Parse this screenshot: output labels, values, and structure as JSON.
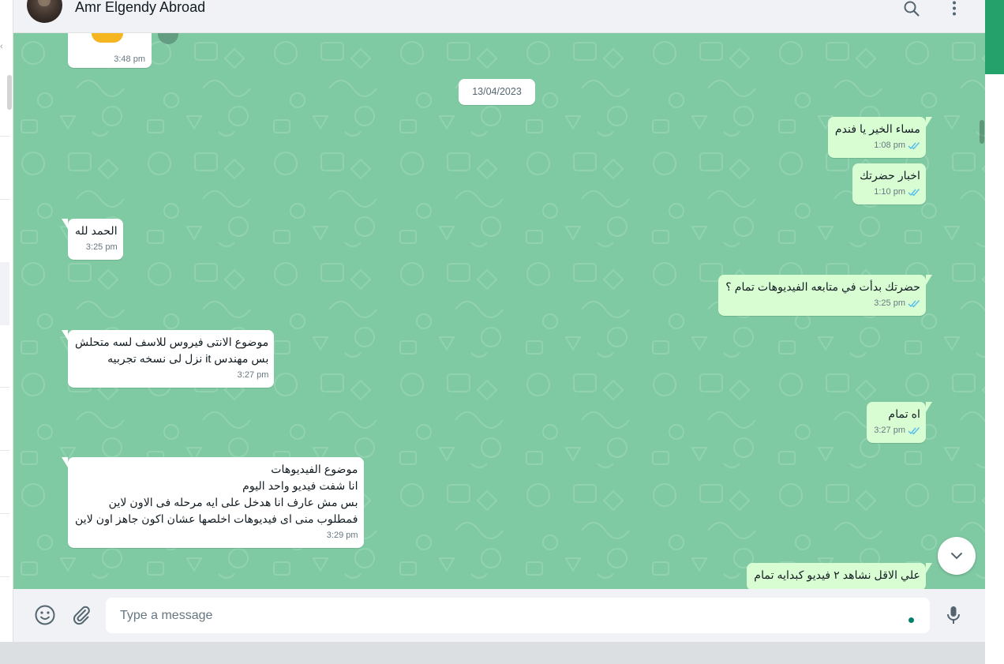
{
  "header": {
    "contact_name": "Amr Elgendy Abroad",
    "icons": [
      "search-icon",
      "menu-icon"
    ]
  },
  "chat": {
    "background_color": "#7fcaa3",
    "date_separator": "13/04/2023",
    "top_sticker_time": "3:48 pm",
    "messages": [
      {
        "direction": "out",
        "text": "مساء الخير يا فندم",
        "time": "1:08 pm",
        "status": "read"
      },
      {
        "direction": "out",
        "text": "اخبار حضرتك",
        "time": "1:10 pm",
        "status": "read"
      },
      {
        "direction": "in",
        "text": "الحمد لله",
        "time": "3:25 pm"
      },
      {
        "direction": "out",
        "text": "حضرتك بدأت في متابعه الفيديوهات تمام ؟",
        "time": "3:25 pm",
        "status": "read"
      },
      {
        "direction": "in",
        "text": "موضوع الانتى فيروس للاسف لسه متحلش\nبس مهندس it نزل لى نسخه تجربيه",
        "time": "3:27 pm"
      },
      {
        "direction": "out",
        "text": "اه تمام",
        "time": "3:27 pm",
        "status": "read"
      },
      {
        "direction": "in",
        "text": "موضوع الفيديوهات\nانا شفت فيديو واحد اليوم\nبس مش عارف انا هدخل على ايه مرحله فى الاون لاين\nفمطلوب منى اى فيديوهات اخلصها عشان اكون جاهز اون لاين",
        "time": "3:29 pm"
      },
      {
        "direction": "out",
        "text": "علي الاقل نشاهد ٢ فيديو كبدايه تمام",
        "time": "",
        "status": "read"
      }
    ]
  },
  "footer": {
    "input_placeholder": "Type a message",
    "icons": [
      "emoji-icon",
      "attach-icon",
      "mic-icon"
    ]
  },
  "colors": {
    "incoming_bubble": "#ffffff",
    "outgoing_bubble": "#d9fdd3",
    "read_ticks": "#53bdeb",
    "header_bg": "#f0f2f5"
  }
}
